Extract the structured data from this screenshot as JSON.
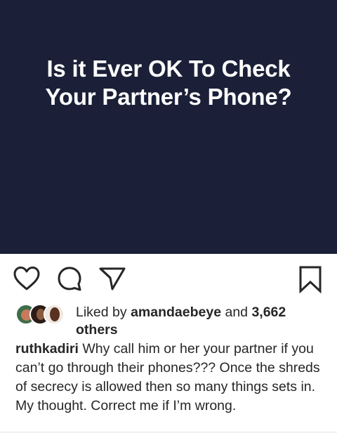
{
  "post": {
    "image_text": "Is it Ever OK To Check Your Partner’s Phone?",
    "background_color": "#1b2038"
  },
  "actions": {
    "like_icon": "heart-icon",
    "comment_icon": "comment-bubble-icon",
    "share_icon": "paper-plane-icon",
    "save_icon": "bookmark-icon"
  },
  "likes": {
    "prefix": "Liked by ",
    "user": "amandaebeye",
    "middle": " and ",
    "count": "3,662",
    "suffix": "others"
  },
  "caption": {
    "username": "ruthkadiri",
    "text": "Why call him or her your partner if you can’t go through their phones??? Once the shreds of secrecy is allowed then so many things sets in. My thought. Correct me if I’m wrong."
  }
}
